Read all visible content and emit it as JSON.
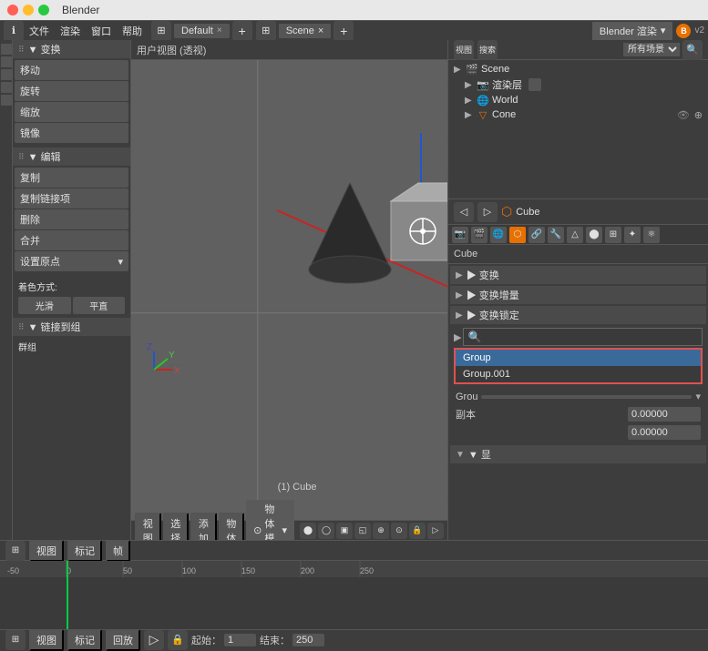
{
  "titlebar": {
    "title": "Blender"
  },
  "menubar": {
    "items": [
      "ℹ",
      "文件",
      "渲染",
      "窗口",
      "帮助"
    ],
    "workspace": "Default",
    "scene": "Scene",
    "render_engine": "Blender 渲染",
    "version": "v2"
  },
  "left_panel": {
    "transform_header": "▼ 变换",
    "transform_btns": [
      "移动",
      "旋转",
      "缩放",
      "镜像"
    ],
    "edit_header": "▼ 编辑",
    "edit_btns": [
      "复制",
      "复制链接项",
      "删除",
      "合并"
    ],
    "origin_btn": "设置原点",
    "color_label": "着色方式:",
    "smooth_btn": "光滑",
    "flat_btn": "平直",
    "chain_header": "▼ 链接到组",
    "group_label": "群组"
  },
  "viewport": {
    "label": "用户视图 (透视)",
    "footer_btns": [
      "视图",
      "选择",
      "添加",
      "物体"
    ],
    "mode": "物体模式",
    "cube_label": "(1) Cube"
  },
  "outliner": {
    "tabs": [
      "视图",
      "搜索"
    ],
    "scene_filter": "所有场景",
    "tree": [
      {
        "indent": 0,
        "arrow": "▶",
        "icon": "🎬",
        "label": "Scene",
        "eye": true
      },
      {
        "indent": 1,
        "arrow": "▶",
        "icon": "📷",
        "label": "渲染层",
        "eye": false
      },
      {
        "indent": 1,
        "arrow": "▶",
        "icon": "🌐",
        "label": "World",
        "eye": false
      },
      {
        "indent": 1,
        "arrow": "▶",
        "icon": "🔺",
        "label": "Cone",
        "eye": true
      }
    ]
  },
  "properties": {
    "active_object": "Cube",
    "object_name": "Cube",
    "sections": [
      "▶ 变换",
      "▶ 变换增量",
      "▶ 变换锁定"
    ],
    "search_placeholder": "",
    "dropdown_items": [
      {
        "label": "Group",
        "selected": true
      },
      {
        "label": "Group.001",
        "selected": false
      }
    ],
    "group_label": "Grou",
    "dupe_label": "副本",
    "value_field": "0.00000",
    "bottom_section": "▼ 显"
  },
  "timeline": {
    "footer_btns": [
      "视图",
      "标记",
      "帧"
    ],
    "playback_btn": "回放",
    "start_label": "起始：",
    "start_value": "1",
    "end_label": "结束：",
    "end_value": "250",
    "ruler_marks": [
      "-50",
      "0",
      "50",
      "100",
      "150",
      "200",
      "250"
    ]
  },
  "icons": {
    "search": "🔍",
    "eye": "👁",
    "camera": "📷",
    "world": "🌐",
    "cone": "▽",
    "cube": "□",
    "scene": "🎬"
  }
}
